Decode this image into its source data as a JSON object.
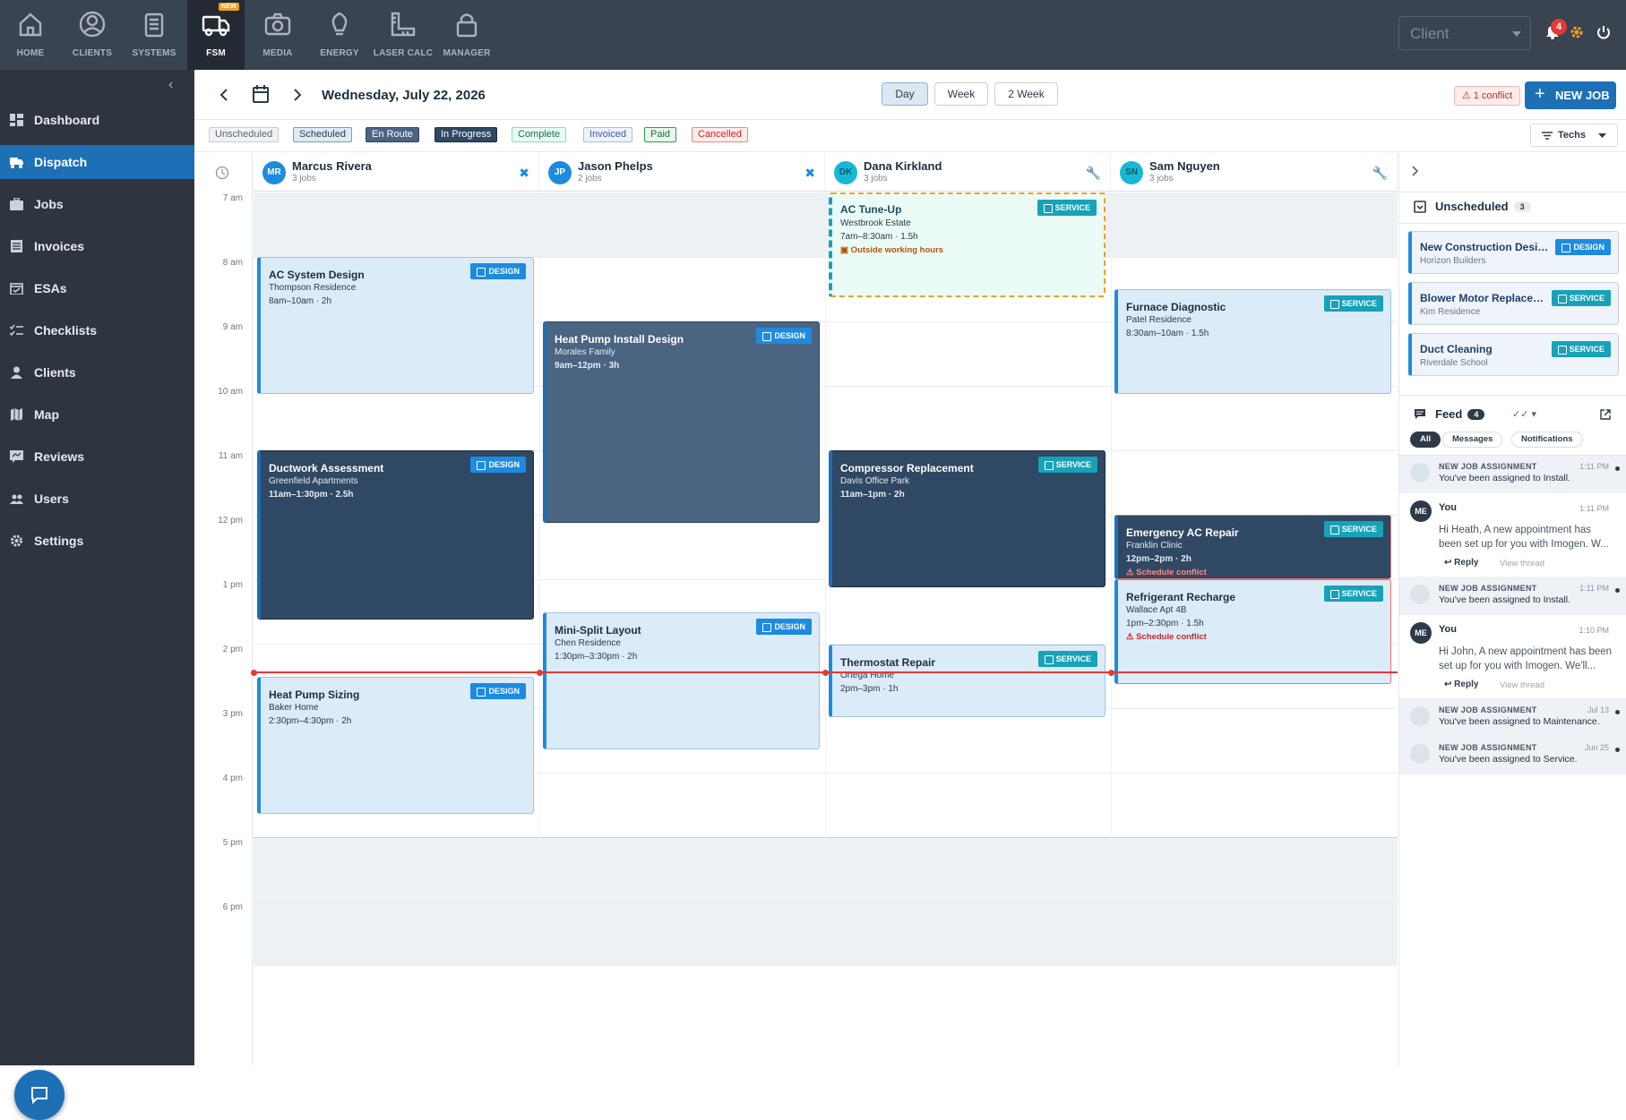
{
  "topnav": {
    "items": [
      {
        "label": "HOME",
        "icon": "home-icon"
      },
      {
        "label": "CLIENTS",
        "icon": "user-circle-icon"
      },
      {
        "label": "SYSTEMS",
        "icon": "clipboard-icon"
      },
      {
        "label": "FSM",
        "icon": "truck-icon",
        "badge": "NEW"
      },
      {
        "label": "MEDIA",
        "icon": "camera-icon"
      },
      {
        "label": "ENERGY",
        "icon": "lightbulb-icon"
      },
      {
        "label": "LASER CALC",
        "icon": "ruler-icon"
      },
      {
        "label": "MANAGER",
        "icon": "lock-icon"
      }
    ],
    "client_placeholder": "Client",
    "notifications_count": "4"
  },
  "sidebar": {
    "items": [
      {
        "label": "Dashboard",
        "icon": "dashboard-icon"
      },
      {
        "label": "Dispatch",
        "icon": "truck-icon"
      },
      {
        "label": "Jobs",
        "icon": "briefcase-icon"
      },
      {
        "label": "Invoices",
        "icon": "invoice-icon"
      },
      {
        "label": "ESAs",
        "icon": "calendar-check-icon"
      },
      {
        "label": "Checklists",
        "icon": "checklist-icon"
      },
      {
        "label": "Clients",
        "icon": "person-icon"
      },
      {
        "label": "Map",
        "icon": "map-icon"
      },
      {
        "label": "Reviews",
        "icon": "review-icon"
      },
      {
        "label": "Users",
        "icon": "users-icon"
      },
      {
        "label": "Settings",
        "icon": "gear-icon"
      }
    ]
  },
  "header": {
    "date": "Wednesday, July 22, 2026",
    "views": [
      "Day",
      "Week",
      "2 Week"
    ],
    "active_view": "Day",
    "conflict": "⚠ 1 conflict",
    "new_job": "NEW JOB"
  },
  "statuses": [
    {
      "label": "Unscheduled"
    },
    {
      "label": "Scheduled"
    },
    {
      "label": "En Route"
    },
    {
      "label": "In Progress"
    },
    {
      "label": "Complete"
    },
    {
      "label": "Invoiced"
    },
    {
      "label": "Paid"
    },
    {
      "label": "Cancelled"
    }
  ],
  "techs_filter": "Techs",
  "time_labels": [
    "7 am",
    "8 am",
    "9 am",
    "10 am",
    "11 am",
    "12 pm",
    "1 pm",
    "2 pm",
    "3 pm",
    "4 pm",
    "5 pm",
    "6 pm"
  ],
  "techs": [
    {
      "initials": "MR",
      "name": "Marcus Rivera",
      "jobs": "3 jobs",
      "color": "#1d8be0"
    },
    {
      "initials": "JP",
      "name": "Jason Phelps",
      "jobs": "2 jobs",
      "color": "#1d8be0"
    },
    {
      "initials": "DK",
      "name": "Dana Kirkland",
      "jobs": "3 jobs",
      "color": "#17b8d4"
    },
    {
      "initials": "SN",
      "name": "Sam Nguyen",
      "jobs": "3 jobs",
      "color": "#17b8d4"
    }
  ],
  "jobs": [
    {
      "title": "AC System Design",
      "client": "Thompson Residence",
      "time": "8am–10am · 2h",
      "tag": "DESIGN"
    },
    {
      "title": "Ductwork Assessment",
      "client": "Greenfield Apartments",
      "time": "11am–1:30pm · 2.5h",
      "tag": "DESIGN"
    },
    {
      "title": "Heat Pump Sizing",
      "client": "Baker Home",
      "time": "2:30pm–4:30pm · 2h",
      "tag": "DESIGN"
    },
    {
      "title": "Heat Pump Install Design",
      "client": "Morales Family",
      "time": "9am–12pm · 3h",
      "tag": "DESIGN"
    },
    {
      "title": "Mini-Split Layout",
      "client": "Chen Residence",
      "time": "1:30pm–3:30pm · 2h",
      "tag": "DESIGN"
    },
    {
      "title": "AC Tune-Up",
      "client": "Westbrook Estate",
      "time": "7am–8:30am · 1.5h",
      "tag": "SERVICE",
      "warning": "Outside working hours"
    },
    {
      "title": "Compressor Replacement",
      "client": "Davis Office Park",
      "time": "11am–1pm · 2h",
      "tag": "SERVICE"
    },
    {
      "title": "Thermostat Repair",
      "client": "Ortega Home",
      "time": "2pm–3pm · 1h",
      "tag": "SERVICE"
    },
    {
      "title": "Furnace Diagnostic",
      "client": "Patel Residence",
      "time": "8:30am–10am · 1.5h",
      "tag": "SERVICE"
    },
    {
      "title": "Emergency AC Repair",
      "client": "Franklin Clinic",
      "time": "12pm–2pm · 2h",
      "tag": "SERVICE",
      "warning": "Schedule conflict"
    },
    {
      "title": "Refrigerant Recharge",
      "client": "Wallace Apt 4B",
      "time": "1pm–2:30pm · 1.5h",
      "tag": "SERVICE",
      "warning": "Schedule conflict"
    }
  ],
  "unscheduled": {
    "title": "Unscheduled",
    "count": "3",
    "items": [
      {
        "title": "New Construction Design",
        "client": "Horizon Builders",
        "tag": "DESIGN"
      },
      {
        "title": "Blower Motor Replacement",
        "client": "Kim Residence",
        "tag": "SERVICE"
      },
      {
        "title": "Duct Cleaning",
        "client": "Riverdale School",
        "tag": "SERVICE"
      }
    ]
  },
  "feed": {
    "title": "Feed",
    "count": "4",
    "tabs": [
      "All",
      "Messages",
      "Notifications"
    ],
    "items": [
      {
        "type": "notif",
        "head": "NEW JOB ASSIGNMENT",
        "time": "1:11 PM",
        "body": "You've been assigned to Install."
      },
      {
        "type": "msg",
        "head": "You",
        "time": "1:11 PM",
        "body": "Hi Heath, A new appointment has been set up for you with Imogen. W...",
        "reply": "Reply",
        "view": "View thread",
        "avatar": "ME"
      },
      {
        "type": "notif",
        "head": "NEW JOB ASSIGNMENT",
        "time": "1:11 PM",
        "body": "You've been assigned to Install."
      },
      {
        "type": "msg",
        "head": "You",
        "time": "1:10 PM",
        "body": "Hi John, A new appointment has been set up for you with Imogen. We'll...",
        "reply": "Reply",
        "view": "View thread",
        "avatar": "ME"
      },
      {
        "type": "notif",
        "head": "NEW JOB ASSIGNMENT",
        "time": "Jul 13",
        "body": "You've been assigned to Maintenance."
      },
      {
        "type": "notif",
        "head": "NEW JOB ASSIGNMENT",
        "time": "Jun 25",
        "body": "You've been assigned to Service."
      }
    ]
  }
}
